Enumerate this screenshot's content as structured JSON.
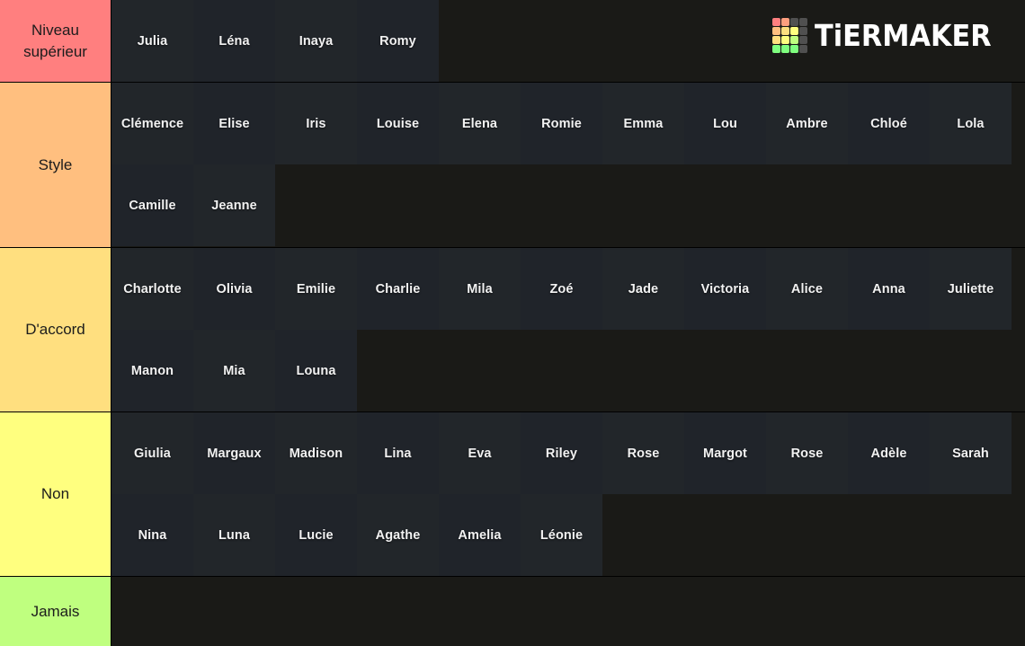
{
  "app": {
    "logo_text": "TiERMAKER",
    "logo_colors": [
      "#ff7f7f",
      "#ff9f7f",
      "#505050",
      "#505050",
      "#ffbf7f",
      "#ffdf7f",
      "#ffff7f",
      "#505050",
      "#ffdf7f",
      "#ffff7f",
      "#bfff7f",
      "#505050",
      "#7fff7f",
      "#7fff7f",
      "#7fff7f",
      "#505050"
    ]
  },
  "tiers": [
    {
      "label": "Niveau supérieur",
      "color": "#ff7f7f",
      "items": [
        "Julia",
        "Léna",
        "Inaya",
        "Romy"
      ]
    },
    {
      "label": "Style",
      "color": "#ffbf7f",
      "items": [
        "Clémence",
        "Elise",
        "Iris",
        "Louise",
        "Elena",
        "Romie",
        "Emma",
        "Lou",
        "Ambre",
        "Chloé",
        "Lola",
        "Camille",
        "Jeanne"
      ]
    },
    {
      "label": "D'accord",
      "color": "#ffdf7f",
      "items": [
        "Charlotte",
        "Olivia",
        "Emilie",
        "Charlie",
        "Mila",
        "Zoé",
        "Jade",
        "Victoria",
        "Alice",
        "Anna",
        "Juliette",
        "Manon",
        "Mia",
        "Louna"
      ]
    },
    {
      "label": "Non",
      "color": "#ffff7f",
      "items": [
        "Giulia",
        "Margaux",
        "Madison",
        "Lina",
        "Eva",
        "Riley",
        "Rose",
        "Margot",
        "Rose",
        "Adèle",
        "Sarah",
        "Nina",
        "Luna",
        "Lucie",
        "Agathe",
        "Amelia",
        "Léonie"
      ]
    },
    {
      "label": "Jamais",
      "color": "#bfff7f",
      "items": []
    }
  ]
}
